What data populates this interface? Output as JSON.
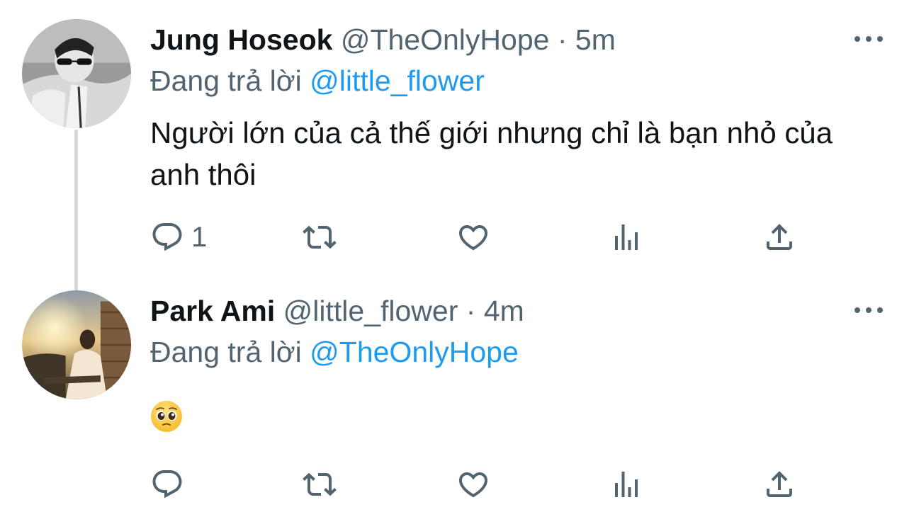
{
  "tweets": [
    {
      "display_name": "Jung Hoseok",
      "handle": "@TheOnlyHope",
      "separator": "·",
      "time": "5m",
      "reply_prefix": "Đang trả lời",
      "reply_to": "@little_flower",
      "text": "Người lớn của cả thế giới nhưng chỉ là bạn nhỏ của anh thôi",
      "reply_count": "1",
      "avatar_icon": "avatar-photo-man-sunglasses"
    },
    {
      "display_name": "Park Ami",
      "handle": "@little_flower",
      "separator": "·",
      "time": "4m",
      "reply_prefix": "Đang trả lời",
      "reply_to": "@TheOnlyHope",
      "text": "🥺",
      "reply_count": "",
      "avatar_icon": "avatar-photo-sunset-girl"
    }
  ],
  "colors": {
    "text": "#0f1419",
    "secondary": "#536471",
    "accent": "#1d9bf0",
    "thread_line": "#cfd9de"
  },
  "icons": [
    "reply-icon",
    "retweet-icon",
    "like-icon",
    "stats-icon",
    "share-icon",
    "more-icon"
  ]
}
